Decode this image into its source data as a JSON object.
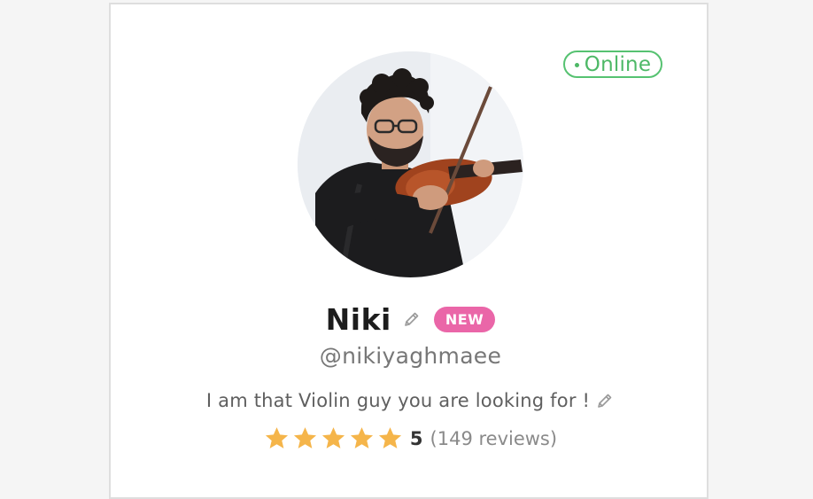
{
  "profile": {
    "status": "Online",
    "name": "Niki",
    "badge": "NEW",
    "handle": "@nikiyaghmaee",
    "bio": "I am that Violin guy you are looking for !",
    "rating": {
      "value": "5",
      "reviews_text": "(149 reviews)",
      "stars": 5
    },
    "avatar": {
      "description_icon": "avatar-photo"
    }
  },
  "colors": {
    "online_green": "#4db866",
    "badge_pink": "#ea66a8",
    "star_gold": "#f5b54a"
  },
  "icons": {
    "edit": "pencil-icon",
    "star": "star-icon",
    "status": "status-dot-icon"
  }
}
